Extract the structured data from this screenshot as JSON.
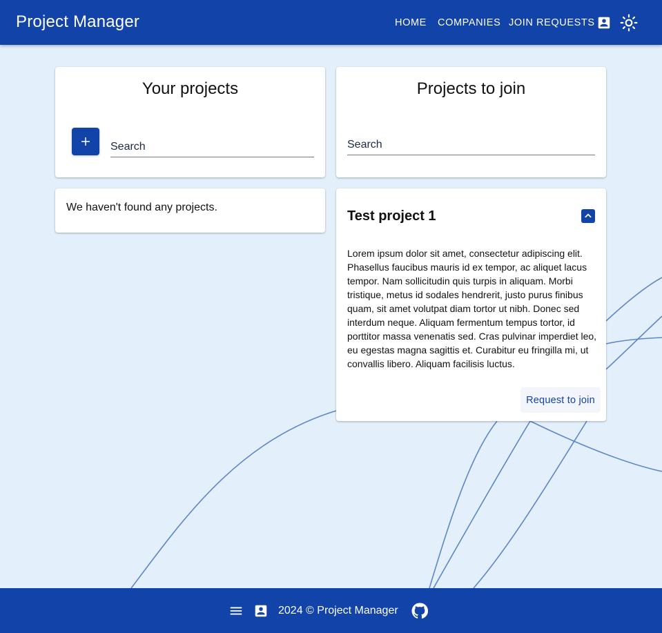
{
  "header": {
    "title": "Project Manager",
    "nav": {
      "home": "HOME",
      "companies": "COMPANIES",
      "join_requests": "JOIN REQUESTS"
    },
    "icons": [
      "account-box-icon",
      "light-mode-icon"
    ]
  },
  "your_projects": {
    "title": "Your projects",
    "search_placeholder": "Search",
    "add_icon": "plus-icon",
    "empty_message": "We haven't found any projects."
  },
  "projects_to_join": {
    "title": "Projects to join",
    "search_placeholder": "Search",
    "items": [
      {
        "name": "Test project 1",
        "description": "Lorem ipsum dolor sit amet, consectetur adipiscing elit. Phasellus faucibus mauris id ex tempor, ac aliquet lacus tempor. Nam sollicitudin quis turpis in aliquam. Morbi tristique, metus id sodales hendrerit, justo purus finibus quam, sit amet volutpat diam tortor ut nibh. Donec sed interdum neque. Aliquam fermentum tempus tortor, id porttitor massa venenatis sed. Cras pulvinar imperdiet leo, eu egestas magna sagittis et. Curabitur eu fringilla mi, ut convallis libero. Aliquam facilisis luctus.",
        "action_label": "Request to join",
        "toggle_icon": "chevron-up-icon"
      }
    ]
  },
  "footer": {
    "copyright": "2024 © Project Manager",
    "icons": [
      "menu-icon",
      "account-box-icon",
      "github-icon"
    ]
  },
  "colors": {
    "primary": "#1243a8",
    "background": "#e3f0fb",
    "card": "#ffffff",
    "decor_lines": "#5b86c7"
  }
}
